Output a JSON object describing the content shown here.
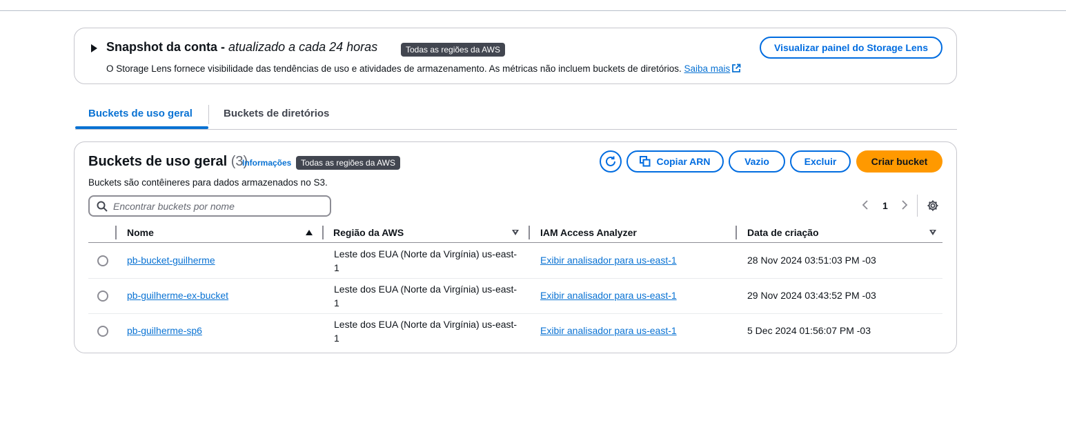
{
  "snapshot": {
    "title": "Snapshot da conta -",
    "subtitle": "atualizado a cada 24 horas",
    "badge": "Todas as regiões da AWS",
    "description": "O Storage Lens fornece visibilidade das tendências de uso e atividades de armazenamento. As métricas não incluem buckets de diretórios.",
    "learn_more": "Saiba mais",
    "lens_button": "Visualizar painel do Storage Lens"
  },
  "tabs": [
    {
      "label": "Buckets de uso geral",
      "active": true
    },
    {
      "label": "Buckets de diretórios",
      "active": false
    }
  ],
  "buckets": {
    "title": "Buckets de uso geral",
    "count": "(3)",
    "info": "Informações",
    "badge": "Todas as regiões da AWS",
    "description": "Buckets são contêineres para dados armazenados no S3.",
    "copy_arn": "Copiar ARN",
    "empty": "Vazio",
    "delete": "Excluir",
    "create": "Criar bucket",
    "search_placeholder": "Encontrar buckets por nome",
    "page": "1",
    "columns": [
      "Nome",
      "Região da AWS",
      "IAM Access Analyzer",
      "Data de criação"
    ],
    "rows": [
      {
        "name": "pb-bucket-guilherme",
        "region": "Leste dos EUA (Norte da Virgínia) us-east-1",
        "iam": "Exibir analisador para us-east-1",
        "date": "28 Nov 2024 03:51:03 PM -03"
      },
      {
        "name": "pb-guilherme-ex-bucket",
        "region": "Leste dos EUA (Norte da Virgínia) us-east-1",
        "iam": "Exibir analisador para us-east-1",
        "date": "29 Nov 2024 03:43:52 PM -03"
      },
      {
        "name": "pb-guilherme-sp6",
        "region": "Leste dos EUA (Norte da Virgínia) us-east-1",
        "iam": "Exibir analisador para us-east-1",
        "date": "5 Dec 2024 01:56:07 PM -03"
      }
    ]
  },
  "colors": {
    "accent": "#0972d3",
    "primary_button": "#ff9900",
    "badge": "#424650"
  }
}
